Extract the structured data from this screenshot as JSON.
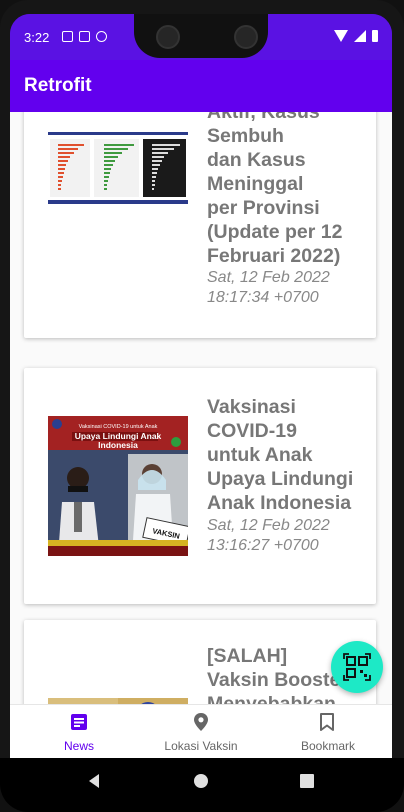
{
  "status_bar": {
    "time": "3:22"
  },
  "app_bar": {
    "title": "Retrofit"
  },
  "news": [
    {
      "title_lines": [
        "Aktif, Kasus",
        "Sembuh",
        "dan Kasus",
        "Meninggal",
        "per Provinsi",
        "(Update per 12",
        "Februari 2022)"
      ],
      "date_lines": [
        "Sat, 12 Feb 2022",
        "18:17:34 +0700"
      ]
    },
    {
      "title_lines": [
        "Vaksinasi",
        "COVID-19",
        "untuk Anak",
        "Upaya Lindungi",
        "Anak Indonesia"
      ],
      "date_lines": [
        "Sat, 12 Feb 2022",
        "13:16:27 +0700"
      ],
      "thumb": {
        "banner": "Vaksinasi COVID-19 untuk Anak",
        "headline_1": "Upaya Lindungi Anak",
        "headline_2": "Indonesia",
        "sign": "VAKSIN"
      }
    },
    {
      "title_lines": [
        "[SALAH]",
        "Vaksin Booster",
        "Menyebabkan"
      ]
    }
  ],
  "bottom_nav": {
    "items": [
      {
        "label": "News",
        "icon": "news-icon",
        "active": true
      },
      {
        "label": "Lokasi Vaksin",
        "icon": "location-pin-icon",
        "active": false
      },
      {
        "label": "Bookmark",
        "icon": "bookmark-icon",
        "active": false
      }
    ]
  },
  "colors": {
    "primary": "#6200ee",
    "status_bar": "#5a12e3",
    "fab": "#1de9c6"
  }
}
